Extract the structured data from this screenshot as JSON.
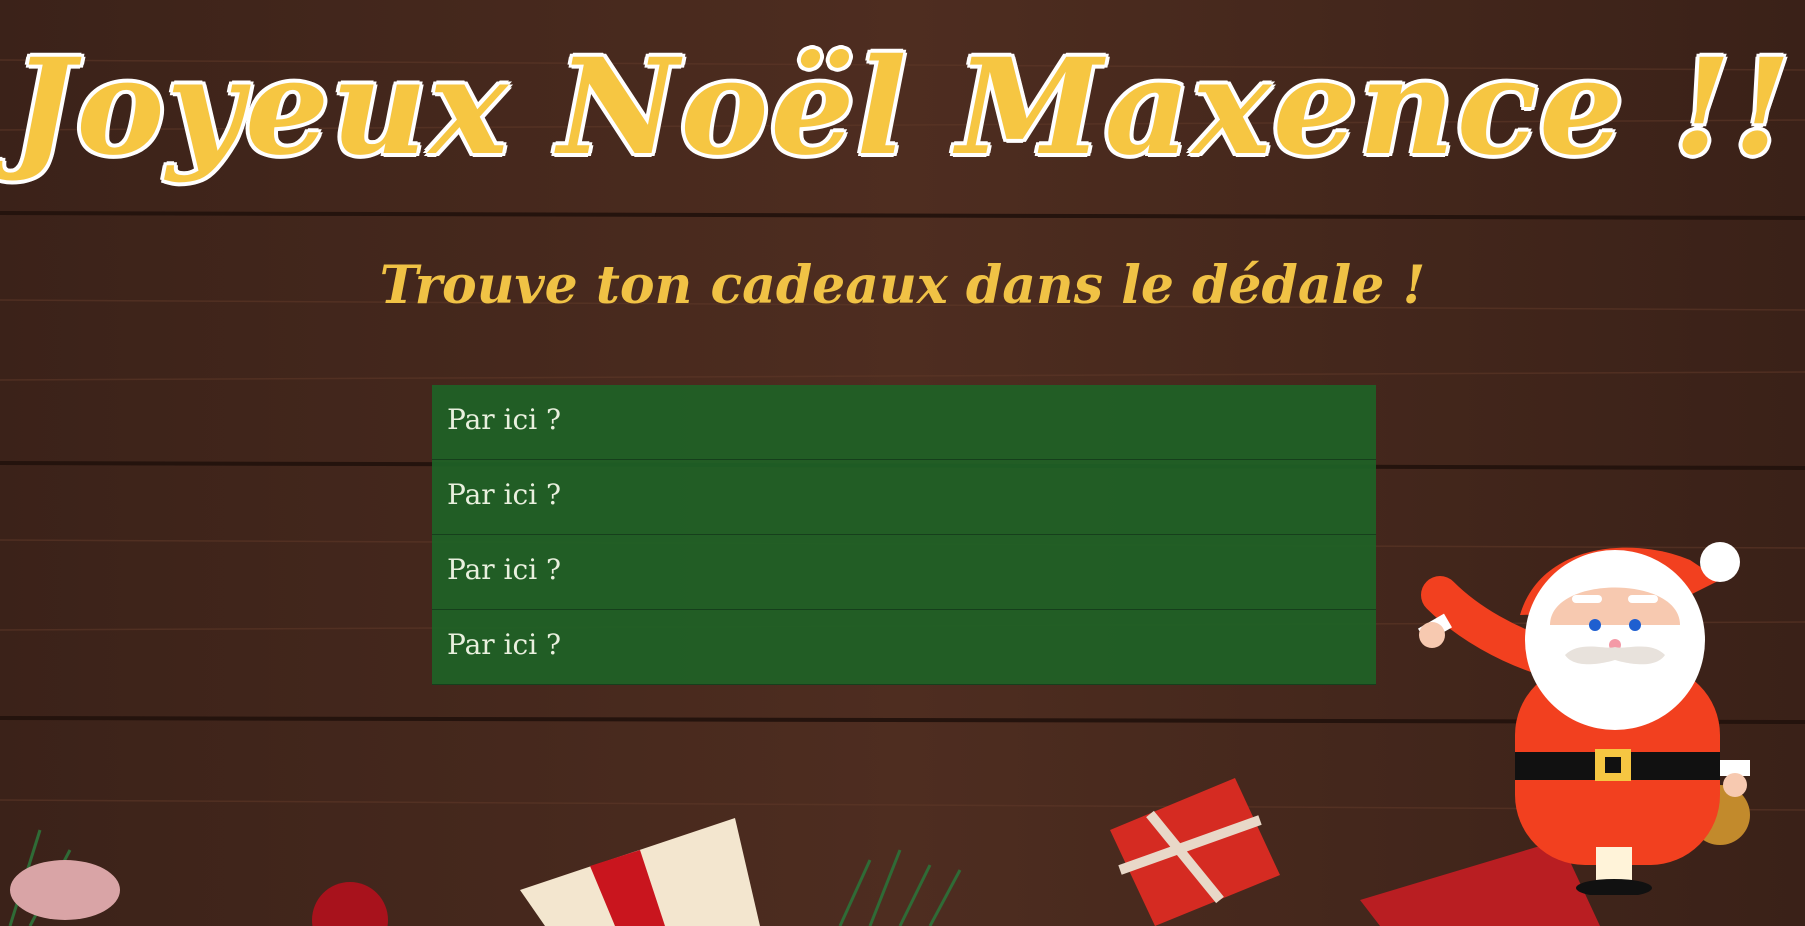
{
  "header": {
    "title": "Joyeux Noël Maxence !!",
    "subtitle": "Trouve ton cadeaux dans le dédale !"
  },
  "maze": {
    "choices": [
      {
        "label": "Par ici ?"
      },
      {
        "label": "Par ici ?"
      },
      {
        "label": "Par ici ?"
      },
      {
        "label": "Par ici ?"
      }
    ]
  },
  "theme": {
    "wood": "#4a2a1e",
    "accent": "#f6c642",
    "choice_bg": "#1e6226",
    "santa_red": "#f2401f"
  },
  "decor": {
    "mascot": "santa-claus-illustration",
    "bottom": "christmas-gifts-and-pine-branches"
  }
}
